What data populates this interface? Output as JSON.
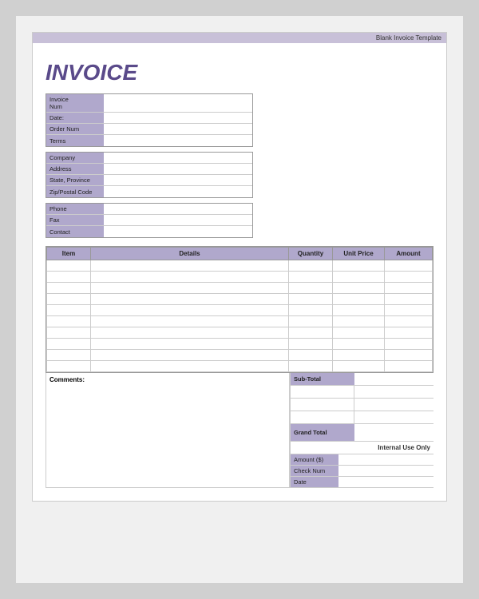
{
  "header": {
    "banner": "Blank Invoice Template",
    "title": "INVOICE"
  },
  "meta_fields": [
    {
      "label": "Invoice Num",
      "value": ""
    },
    {
      "label": "Date:",
      "value": ""
    },
    {
      "label": "Order Num",
      "value": ""
    },
    {
      "label": "Terms",
      "value": ""
    }
  ],
  "company_fields": [
    {
      "label": "Company",
      "value": ""
    },
    {
      "label": "Address",
      "value": ""
    },
    {
      "label": "State, Province",
      "value": ""
    },
    {
      "label": "Zip/Postal Code",
      "value": ""
    }
  ],
  "contact_fields": [
    {
      "label": "Phone",
      "value": ""
    },
    {
      "label": "Fax",
      "value": ""
    },
    {
      "label": "Contact",
      "value": ""
    }
  ],
  "table": {
    "headers": [
      "Item",
      "Details",
      "Quantity",
      "Unit Price",
      "Amount"
    ],
    "rows": [
      [
        "",
        "",
        "",
        "",
        ""
      ],
      [
        "",
        "",
        "",
        "",
        ""
      ],
      [
        "",
        "",
        "",
        "",
        ""
      ],
      [
        "",
        "",
        "",
        "",
        ""
      ],
      [
        "",
        "",
        "",
        "",
        ""
      ],
      [
        "",
        "",
        "",
        "",
        ""
      ],
      [
        "",
        "",
        "",
        "",
        ""
      ],
      [
        "",
        "",
        "",
        "",
        ""
      ],
      [
        "",
        "",
        "",
        "",
        ""
      ],
      [
        "",
        "",
        "",
        "",
        ""
      ]
    ]
  },
  "comments_label": "Comments:",
  "totals": {
    "sub_total_label": "Sub-Total",
    "empty_rows": 3,
    "grand_total_label": "Grand Total",
    "internal_use_label": "Internal Use Only",
    "payment_fields": [
      {
        "label": "Amount ($)",
        "value": ""
      },
      {
        "label": "Check Num",
        "value": ""
      },
      {
        "label": "Date",
        "value": ""
      }
    ]
  }
}
